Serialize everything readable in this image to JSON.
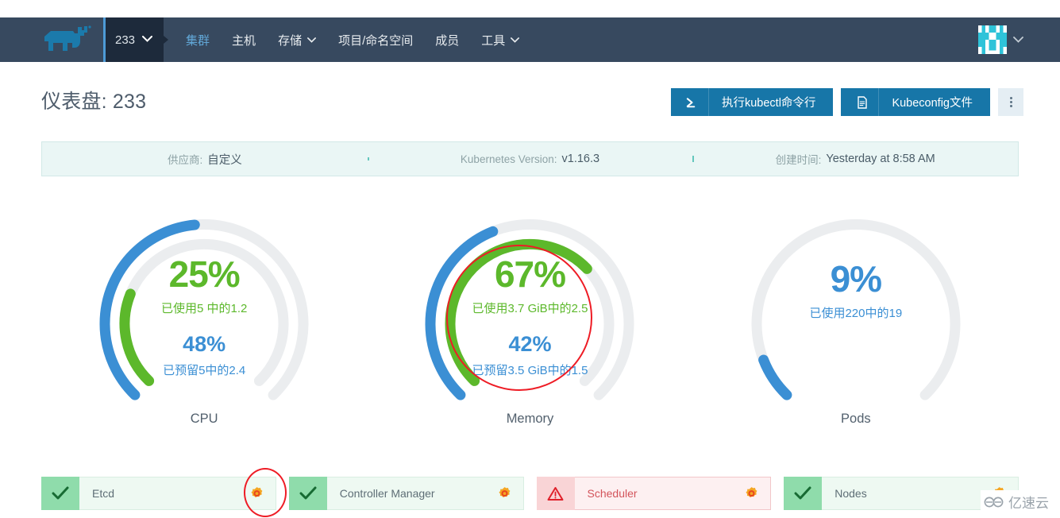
{
  "header": {
    "logo_name": "rancher-cow-logo",
    "cluster_selector": {
      "label": "233",
      "caret": "⌄"
    },
    "nav_items": [
      {
        "name": "clusters",
        "label": "集群",
        "active": true,
        "caret": ""
      },
      {
        "name": "hosts",
        "label": "主机",
        "active": false,
        "caret": ""
      },
      {
        "name": "storage",
        "label": "存储",
        "active": false,
        "caret": "⌄"
      },
      {
        "name": "projects",
        "label": "项目/命名空间",
        "active": false,
        "caret": ""
      },
      {
        "name": "members",
        "label": "成员",
        "active": false,
        "caret": ""
      },
      {
        "name": "tools",
        "label": "工具",
        "active": false,
        "caret": "⌄"
      }
    ],
    "user_menu": {
      "avatar_name": "user-avatar",
      "caret": "⌄"
    }
  },
  "page": {
    "title": "仪表盘: 233",
    "actions": {
      "kubectl": {
        "label": "执行kubectl命令行",
        "icon": "≥"
      },
      "kubeconfig": {
        "label": "Kubeconfig文件",
        "icon": "🗋"
      },
      "more": {
        "label": "more-actions"
      }
    }
  },
  "infobar": [
    {
      "name": "provider",
      "key": "供应商:",
      "value": "自定义"
    },
    {
      "name": "k8s-version",
      "key": "Kubernetes Version:",
      "value": "v1.16.3"
    },
    {
      "name": "created",
      "key": "创建时间:",
      "value": "Yesterday at 8:58 AM"
    }
  ],
  "chart_data": {
    "type": "gauge",
    "title": "Cluster resource gauges",
    "colors": {
      "used": "#5cb82b",
      "reserved": "#3b8fd4",
      "track": "#ebedef",
      "annotation": "#ee1c25"
    },
    "gauges": [
      {
        "name": "cpu",
        "label": "CPU",
        "used_percent": 25,
        "used_value": "25%",
        "used_text": "已使用5 中的1.2",
        "used_of": 5,
        "used_amount": 1.2,
        "reserved_percent": 48,
        "reserved_value": "48%",
        "reserved_text": "已预留5中的2.4",
        "reserved_of": 5,
        "reserved_amount": 2.4,
        "annotated": false
      },
      {
        "name": "memory",
        "label": "Memory",
        "used_percent": 67,
        "used_value": "67%",
        "used_text": "已使用3.7 GiB中的2.5",
        "used_of": 3.7,
        "used_amount": 2.5,
        "reserved_percent": 42,
        "reserved_value": "42%",
        "reserved_text": "已预留3.5 GiB中的1.5",
        "reserved_of": 3.5,
        "reserved_amount": 1.5,
        "annotated": true
      },
      {
        "name": "pods",
        "label": "Pods",
        "used_percent": 9,
        "used_value": "9%",
        "used_text": "已使用220中的19",
        "used_of": 220,
        "used_amount": 19,
        "reserved_percent": null,
        "reserved_value": "",
        "reserved_text": "",
        "annotated": false
      }
    ]
  },
  "components": [
    {
      "name": "etcd",
      "label": "Etcd",
      "status": "ok",
      "icon": "✔",
      "gear": "gear-icon",
      "annotated": true
    },
    {
      "name": "controller-manager",
      "label": "Controller Manager",
      "status": "ok",
      "icon": "✔",
      "gear": "gear-icon",
      "annotated": false
    },
    {
      "name": "scheduler",
      "label": "Scheduler",
      "status": "warn",
      "icon": "⚠",
      "gear": "gear-icon",
      "annotated": false
    },
    {
      "name": "nodes",
      "label": "Nodes",
      "status": "ok",
      "icon": "✔",
      "gear": "gear-icon",
      "annotated": false
    }
  ],
  "watermark": {
    "text": "亿速云"
  }
}
